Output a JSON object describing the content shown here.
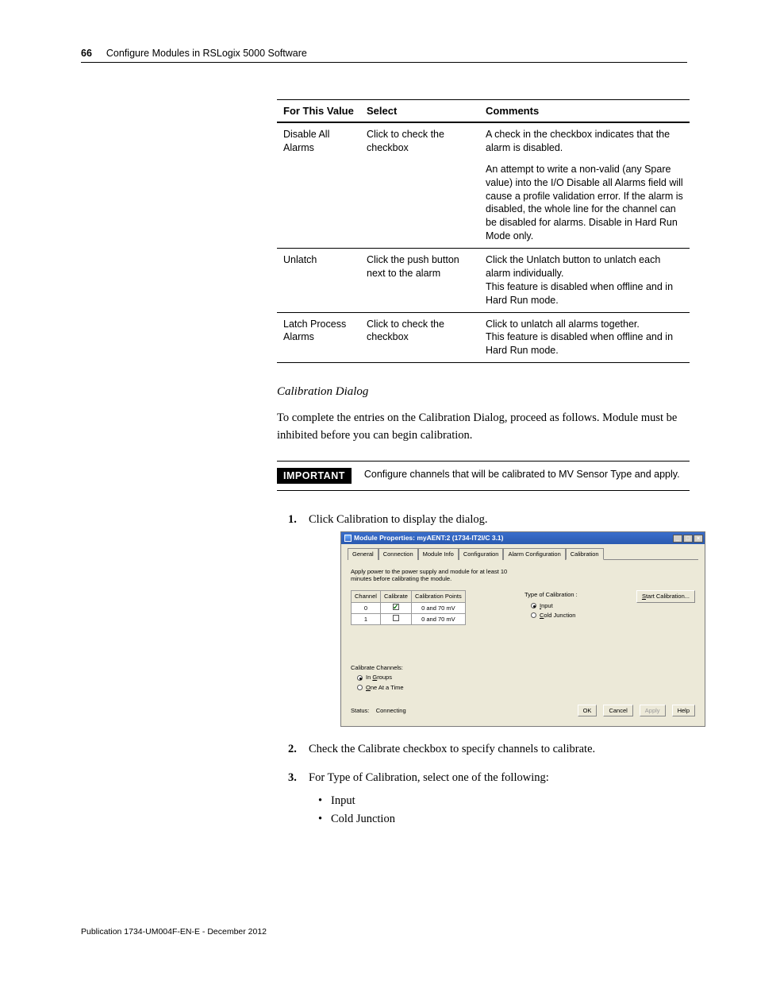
{
  "header": {
    "page_number": "66",
    "section_title": "Configure Modules in RSLogix 5000 Software"
  },
  "table": {
    "headers": [
      "For This Value",
      "Select",
      "Comments"
    ],
    "rows": [
      {
        "value": "Disable All Alarms",
        "select": "Click to check the checkbox",
        "comments_p1": "A check in the checkbox indicates that the alarm is disabled.",
        "comments_p2": "An attempt to write a non-valid (any Spare value) into the I/O Disable all Alarms field will cause a profile validation error. If the alarm is disabled, the whole line for the channel can be disabled for alarms. Disable in Hard Run Mode only."
      },
      {
        "value": "Unlatch",
        "select": "Click the push button next to the alarm",
        "comments_p1": "Click the Unlatch button to unlatch each alarm individually.\nThis feature is disabled when offline and in Hard Run mode."
      },
      {
        "value": "Latch Process Alarms",
        "select": "Click to check the checkbox",
        "comments_p1": "Click to unlatch all alarms together.\nThis feature is disabled when offline and in Hard Run mode."
      }
    ]
  },
  "subheading": "Calibration Dialog",
  "body_para": "To complete the entries on the Calibration Dialog, proceed as follows. Module must be inhibited before you can begin calibration.",
  "important": {
    "label": "IMPORTANT",
    "text": "Configure channels that will be calibrated to MV Sensor Type and apply."
  },
  "steps": {
    "s1": "Click Calibration to display the dialog.",
    "s2": "Check the Calibrate checkbox to specify channels to calibrate.",
    "s3": "For Type of Calibration, select one of the following:",
    "s3_items": [
      "Input",
      "Cold Junction"
    ]
  },
  "dialog": {
    "title": "Module Properties: myAENT:2 (1734-IT2I/C 3.1)",
    "winbtns": {
      "min": "_",
      "max": "□",
      "close": "×"
    },
    "tabs": [
      "General",
      "Connection",
      "Module Info",
      "Configuration",
      "Alarm Configuration",
      "Calibration"
    ],
    "hint": "Apply power to the power supply and module for at least 10 minutes before calibrating the module.",
    "cal_table": {
      "headers": [
        "Channel",
        "Calibrate",
        "Calibration Points"
      ],
      "rows": [
        {
          "ch": "0",
          "checked": true,
          "points": "0 and 70 mV"
        },
        {
          "ch": "1",
          "checked": false,
          "points": "0 and 70 mV"
        }
      ]
    },
    "type_label": "Type of Calibration :",
    "type_options": {
      "input": "Input",
      "cold": "Cold Junction"
    },
    "start_btn": "Start Calibration...",
    "calchan_label": "Calibrate Channels:",
    "calchan_options": {
      "groups": "In Groups",
      "one": "One At a Time"
    },
    "status_label": "Status:",
    "status_value": "Connecting",
    "buttons": {
      "ok": "OK",
      "cancel": "Cancel",
      "apply": "Apply",
      "help": "Help"
    }
  },
  "footer": "Publication 1734-UM004F-EN-E - December 2012"
}
